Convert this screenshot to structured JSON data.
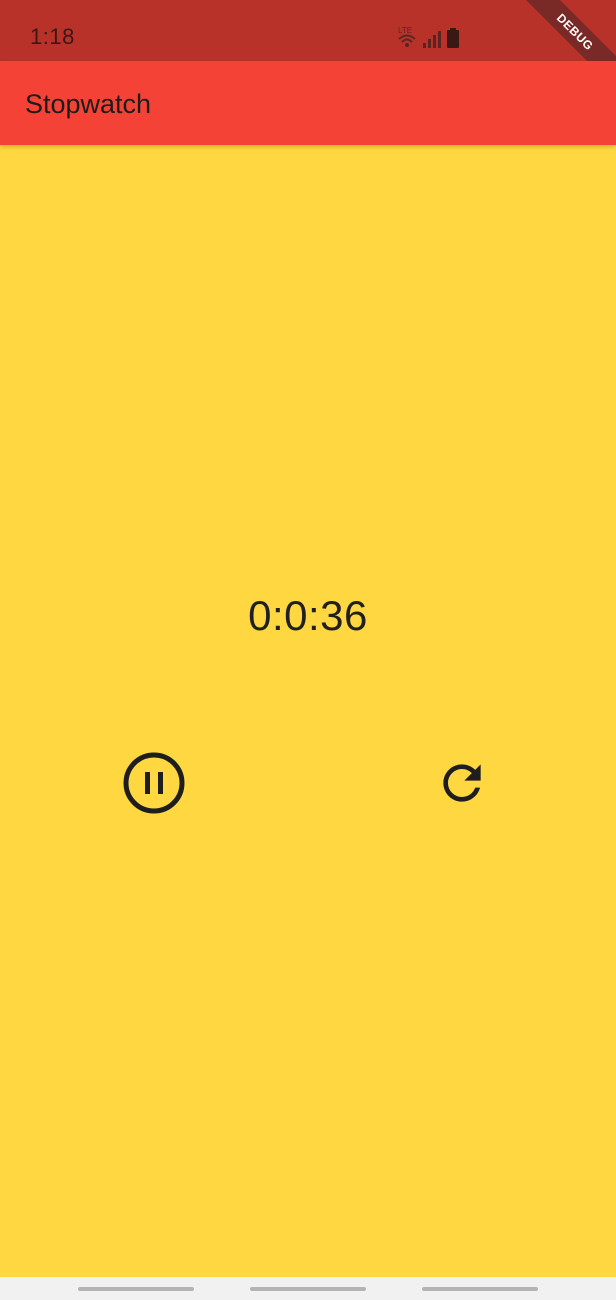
{
  "status_bar": {
    "time": "1:18",
    "network_label": "LTE",
    "icons": [
      "wifi-icon",
      "signal-icon",
      "battery-icon"
    ]
  },
  "debug_banner": "DEBUG",
  "app_bar": {
    "title": "Stopwatch"
  },
  "timer": {
    "display": "0:0:36"
  },
  "controls": {
    "pause_icon": "pause-circle-icon",
    "reset_icon": "refresh-icon"
  },
  "colors": {
    "background": "#FFD740",
    "app_bar": "#F44336",
    "status_bar": "#B8322A",
    "icon_color": "#1E1E1E"
  }
}
